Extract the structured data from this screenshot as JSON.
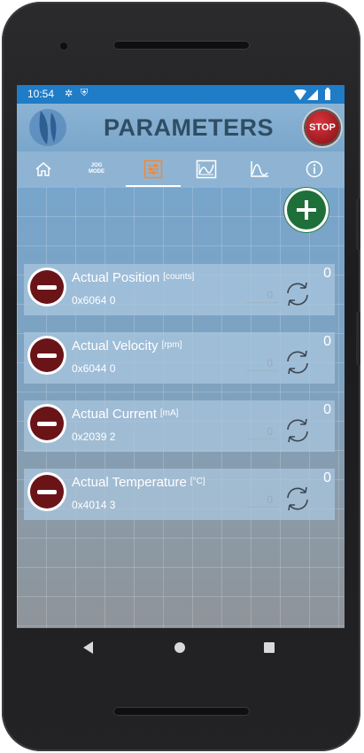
{
  "status_bar": {
    "time": "10:54"
  },
  "app_bar": {
    "title": "PARAMETERS",
    "stop_label": "STOP"
  },
  "tabs": [
    {
      "name": "home",
      "icon": "home-icon"
    },
    {
      "name": "jog-mode",
      "label_line1": "JOG",
      "label_line2": "MODE"
    },
    {
      "name": "parameters",
      "icon": "sliders-icon",
      "active": true
    },
    {
      "name": "scope",
      "icon": "scope-icon"
    },
    {
      "name": "graph",
      "icon": "graph-icon"
    },
    {
      "name": "info",
      "icon": "info-icon"
    }
  ],
  "colors": {
    "accent_tab": "#f0883a",
    "status_bar": "#1f7cc7",
    "add_button": "#1f6f3a",
    "remove_button": "#6a1418"
  },
  "parameters": [
    {
      "name": "Actual Position",
      "unit": "[counts]",
      "address": "0x6064 0",
      "value": "0",
      "input_value": "0"
    },
    {
      "name": "Actual Velocity",
      "unit": "[rpm]",
      "address": "0x6044 0",
      "value": "0",
      "input_value": "0"
    },
    {
      "name": "Actual Current",
      "unit": "[mA]",
      "address": "0x2039 2",
      "value": "0",
      "input_value": "0"
    },
    {
      "name": "Actual Temperature",
      "unit": "[°C]",
      "address": "0x4014 3",
      "value": "0",
      "input_value": "0"
    }
  ]
}
